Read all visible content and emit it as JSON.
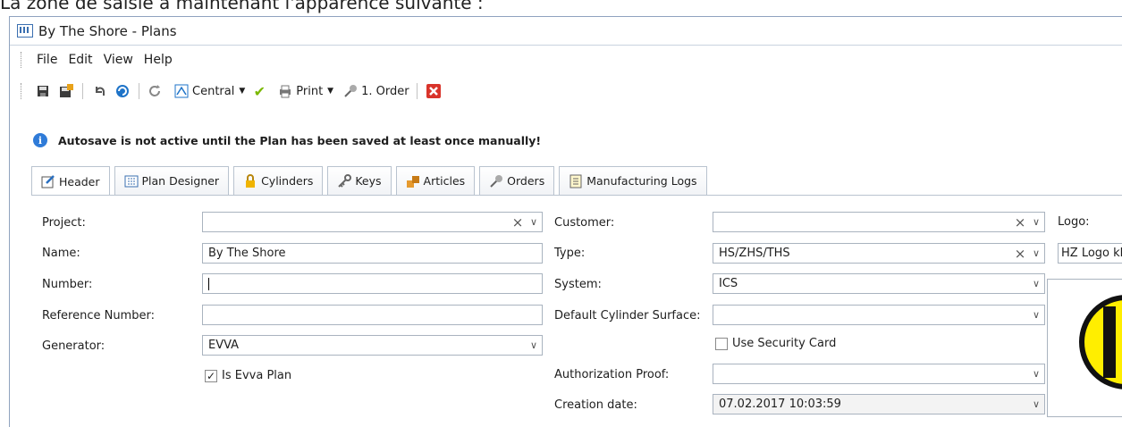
{
  "caption": "La zone de saisie a maintenant l'apparence suivante :",
  "window": {
    "title": "By The Shore - Plans"
  },
  "menu": [
    "File",
    "Edit",
    "View",
    "Help"
  ],
  "toolbar": {
    "central_label": "Central",
    "print_label": "Print",
    "order_label": "1. Order"
  },
  "info": {
    "message": "Autosave is not active until the Plan has been saved at least once manually!"
  },
  "tabs": [
    "Header",
    "Plan Designer",
    "Cylinders",
    "Keys",
    "Articles",
    "Orders",
    "Manufacturing Logs"
  ],
  "form": {
    "project_label": "Project:",
    "project_value": "",
    "name_label": "Name:",
    "name_value": "By The Shore",
    "number_label": "Number:",
    "number_value": "",
    "reference_label": "Reference Number:",
    "reference_value": "",
    "generator_label": "Generator:",
    "generator_value": "EVVA",
    "is_evva_label": "Is Evva Plan",
    "is_evva_checked": true,
    "customer_label": "Customer:",
    "customer_value": "",
    "type_label": "Type:",
    "type_value": "HS/ZHS/THS",
    "system_label": "System:",
    "system_value": "ICS",
    "surface_label": "Default Cylinder Surface:",
    "surface_value": "",
    "security_card_label": "Use Security Card",
    "security_card_checked": false,
    "auth_label": "Authorization Proof:",
    "auth_value": "",
    "creation_label": "Creation date:",
    "creation_value": "07.02.2017 10:03:59",
    "logo_label": "Logo:",
    "logo_value": "HZ Logo kl"
  },
  "colors": {
    "logo_yellow": "#ffee00",
    "close_red": "#d9342b",
    "info_blue": "#2f7bd8"
  }
}
